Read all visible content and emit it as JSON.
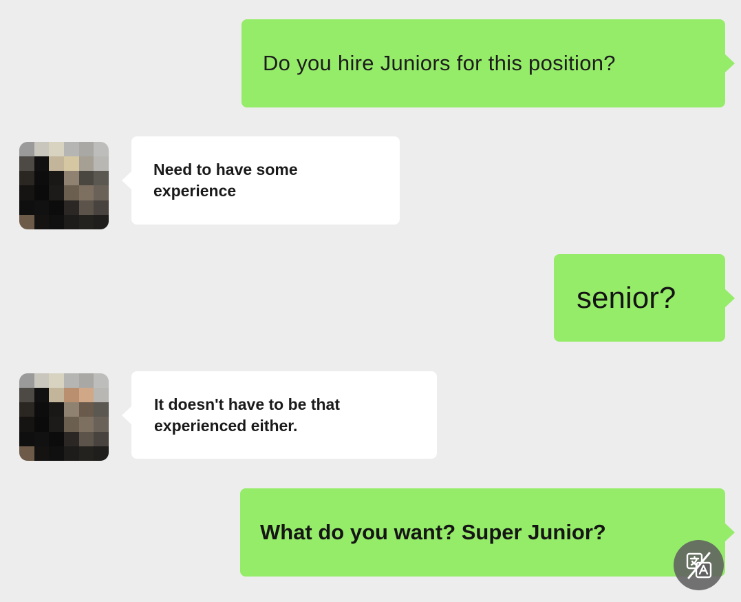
{
  "conversation": {
    "messages": [
      {
        "from": "me",
        "text": "Do you hire Juniors for this position?"
      },
      {
        "from": "other",
        "text": "Need to have some\nexperience"
      },
      {
        "from": "me",
        "text": "senior?"
      },
      {
        "from": "other",
        "text": "It doesn't have to be that\nexperienced either."
      },
      {
        "from": "me",
        "text": "What do you want? Super Junior?"
      }
    ]
  },
  "colors": {
    "background": "#ededed",
    "sent_bubble": "#95ec69",
    "received_bubble": "#ffffff",
    "fab": "#606060"
  },
  "icons": {
    "avatar": "pixelated-profile-picture",
    "translate_button": "translate-icon"
  }
}
